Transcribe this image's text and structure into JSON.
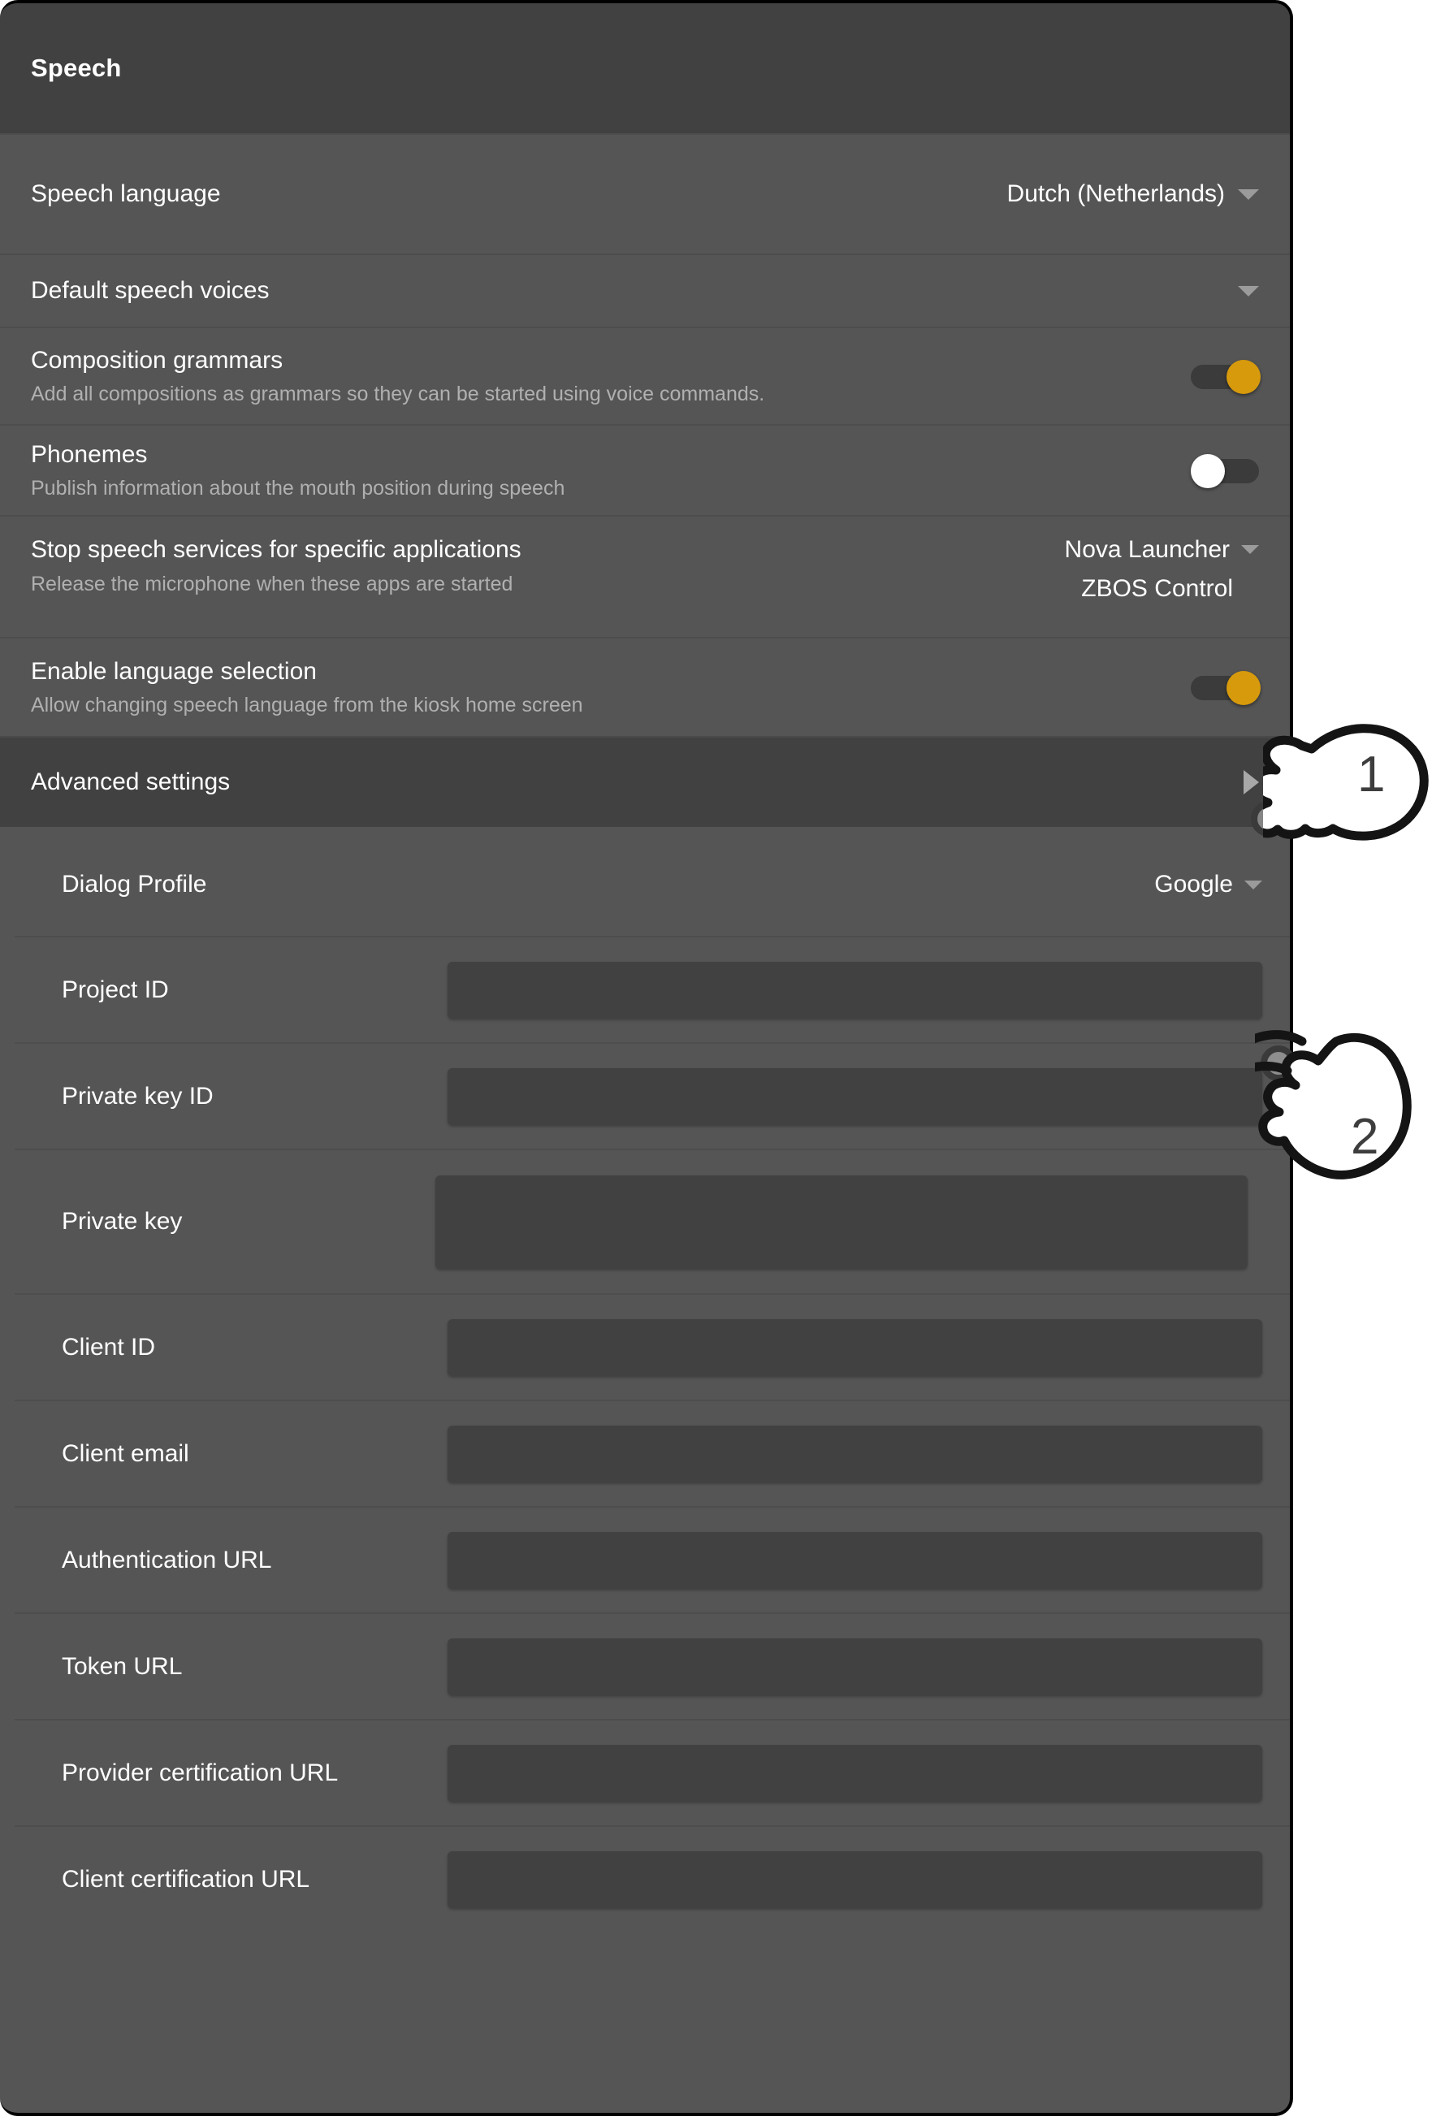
{
  "window": {
    "title": "Speech"
  },
  "settings": {
    "speech_language": {
      "label": "Speech language",
      "value": "Dutch (Netherlands)",
      "caret_icon": "chevron-down-icon"
    },
    "default_speech_voices": {
      "label": "Default speech voices",
      "caret_icon": "chevron-down-icon"
    },
    "composition_grammars": {
      "label": "Composition grammars",
      "description": "Add all compositions as grammars so they can be started using voice commands.",
      "toggle_state": "on"
    },
    "phonemes": {
      "label": "Phonemes",
      "description": "Publish information about the mouth position during speech",
      "toggle_state": "off"
    },
    "stop_speech_services": {
      "label": "Stop speech services for specific applications",
      "description": "Release the microphone when these apps are started",
      "value_primary": "Nova Launcher",
      "value_secondary": "ZBOS Control",
      "caret_icon": "chevron-down-icon"
    },
    "enable_language_selection": {
      "label": "Enable language selection",
      "description": "Allow changing speech language from the kiosk home screen",
      "toggle_state": "on"
    },
    "advanced_settings": {
      "label": "Advanced settings",
      "expander_icon": "chevron-right-icon"
    }
  },
  "advanced": {
    "dialog_profile": {
      "label": "Dialog Profile",
      "value": "Google",
      "caret_icon": "chevron-down-icon"
    },
    "fields": [
      {
        "label": "Project ID",
        "value": "",
        "size": "normal"
      },
      {
        "label": "Private key ID",
        "value": "",
        "size": "normal"
      },
      {
        "label": "Private key",
        "value": "",
        "size": "tall"
      },
      {
        "label": "Client ID",
        "value": "",
        "size": "normal"
      },
      {
        "label": "Client email",
        "value": "",
        "size": "normal"
      },
      {
        "label": "Authentication URL",
        "value": "",
        "size": "normal"
      },
      {
        "label": "Token URL",
        "value": "",
        "size": "normal"
      },
      {
        "label": "Provider certification URL",
        "value": "",
        "size": "normal"
      },
      {
        "label": "Client certification URL",
        "value": "",
        "size": "normal"
      }
    ]
  },
  "annotations": {
    "step_1": "1",
    "step_2": "2"
  },
  "colors": {
    "panel_background": "#555555",
    "header_background": "#414141",
    "toggle_on": "#d79a0c",
    "toggle_off_knob": "#ffffff",
    "toggle_track": "#3b3b3b",
    "field_background": "#414141",
    "primary_text": "#ffffff",
    "secondary_text": "#b0b0b0",
    "caret": "#9b9b9b"
  }
}
